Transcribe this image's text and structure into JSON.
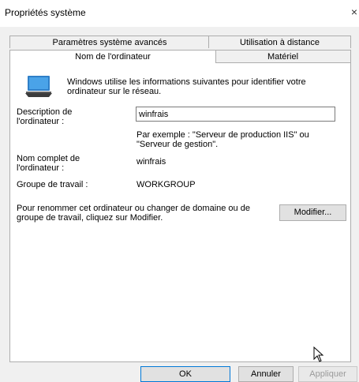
{
  "window": {
    "title": "Propriétés système",
    "close": "×"
  },
  "tabs": {
    "top": [
      "Paramètres système avancés",
      "Utilisation à distance"
    ],
    "bottom": [
      "Nom de l'ordinateur",
      "Matériel"
    ]
  },
  "panel": {
    "intro": "Windows utilise les informations suivantes pour identifier votre ordinateur sur le réseau.",
    "description_label": "Description de l'ordinateur :",
    "description_value": "winfrais",
    "example": "Par exemple : \"Serveur de production IIS\" ou \"Serveur de gestion\".",
    "fullname_label": "Nom complet de l'ordinateur :",
    "fullname_value": "winfrais",
    "workgroup_label": "Groupe de travail :",
    "workgroup_value": "WORKGROUP",
    "rename_text": "Pour renommer cet ordinateur ou changer de domaine ou de groupe de travail, cliquez sur Modifier.",
    "modify_button": "Modifier..."
  },
  "footer": {
    "ok": "OK",
    "cancel": "Annuler",
    "apply": "Appliquer"
  },
  "icons": [
    "computer-icon",
    "mouse-cursor-icon",
    "close-icon"
  ]
}
